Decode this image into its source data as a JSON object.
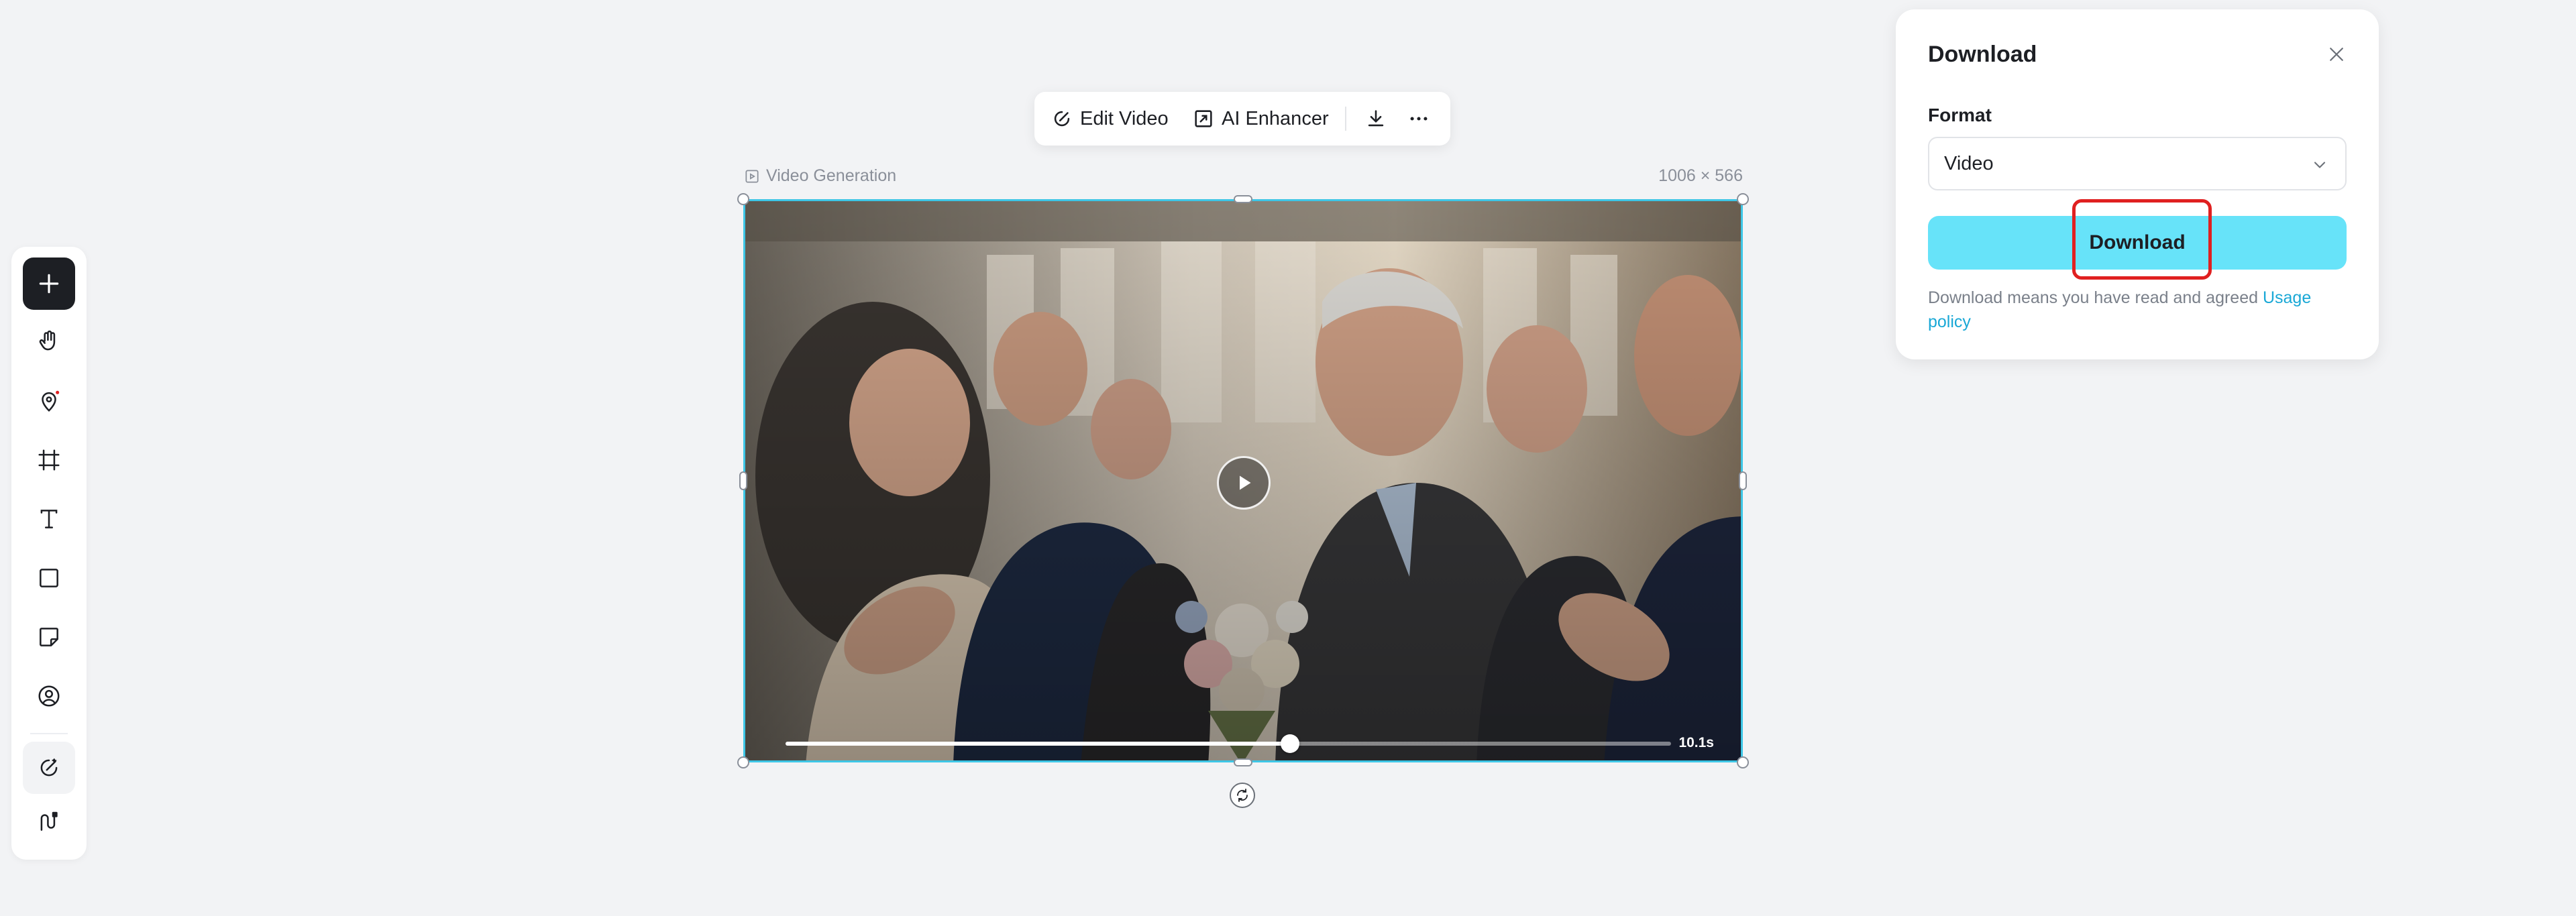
{
  "toolbar": {
    "items": [
      {
        "name": "add",
        "icon": "plus-icon"
      },
      {
        "name": "hand",
        "icon": "hand-icon"
      },
      {
        "name": "pin",
        "icon": "map-pin-icon"
      },
      {
        "name": "frame",
        "icon": "frame-icon"
      },
      {
        "name": "text",
        "icon": "text-icon"
      },
      {
        "name": "shape",
        "icon": "square-icon"
      },
      {
        "name": "sticky-note",
        "icon": "sticky-note-icon"
      },
      {
        "name": "avatar",
        "icon": "user-circle-icon"
      },
      {
        "name": "magic-edit",
        "icon": "magic-brush-icon"
      },
      {
        "name": "workflow",
        "icon": "workflow-icon"
      }
    ]
  },
  "floating_toolbar": {
    "edit_video_label": "Edit Video",
    "ai_enhancer_label": "AI Enhancer"
  },
  "node": {
    "label": "Video Generation",
    "size": "1006 × 566",
    "duration": "10.1s",
    "progress": 0.57
  },
  "download_panel": {
    "title": "Download",
    "format_label": "Format",
    "format_value": "Video",
    "button_label": "Download",
    "policy_text": "Download means you have read and agreed ",
    "policy_link": "Usage policy"
  },
  "colors": {
    "accent": "#3ec6e6",
    "download_button": "#67e3f9",
    "highlight": "#e02020",
    "link": "#19a8d6"
  }
}
